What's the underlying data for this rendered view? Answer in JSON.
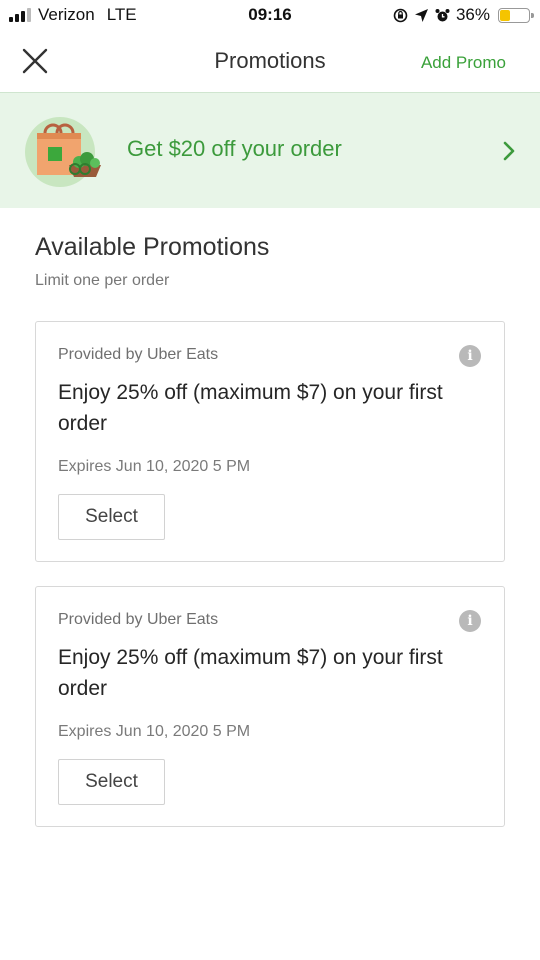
{
  "status_bar": {
    "carrier": "Verizon",
    "network": "LTE",
    "time": "09:16",
    "battery_percent": "36%",
    "battery_level": 0.36,
    "icons": [
      "signal-icon",
      "screen-lock-icon",
      "location-arrow-icon",
      "alarm-icon",
      "battery-icon"
    ]
  },
  "nav": {
    "title": "Promotions",
    "add_promo_label": "Add Promo",
    "close_icon": "close-icon"
  },
  "banner": {
    "text": "Get $20 off your order",
    "icon": "grocery-bag-icon",
    "chevron_icon": "chevron-right-icon",
    "bg_color": "#e8f5e8",
    "accent_color": "#3c9a3c"
  },
  "section": {
    "title": "Available Promotions",
    "subtitle": "Limit one per order"
  },
  "promotions": [
    {
      "provider": "Provided by Uber Eats",
      "description": "Enjoy 25% off (maximum $7) on your first order",
      "expiry": "Expires Jun 10, 2020 5 PM",
      "select_label": "Select"
    },
    {
      "provider": "Provided by Uber Eats",
      "description": "Enjoy 25% off (maximum $7) on your first order",
      "expiry": "Expires Jun 10, 2020 5 PM",
      "select_label": "Select"
    }
  ]
}
